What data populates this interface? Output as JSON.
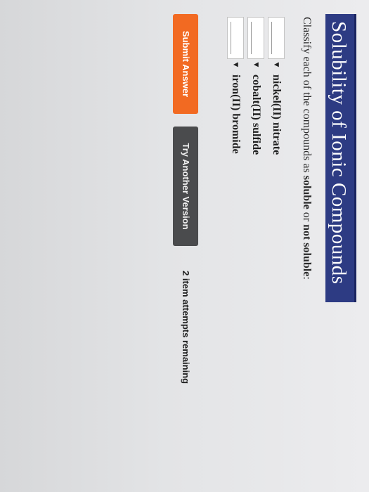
{
  "header": {
    "title": "Solubility of Ionic Compounds"
  },
  "instructions": {
    "prefix": "Classify each of the compounds as ",
    "soluble": "soluble",
    "middle": " or ",
    "not_soluble": "not soluble",
    "suffix": ":"
  },
  "compounds": [
    {
      "name": "nickel(II) nitrate",
      "selected": ""
    },
    {
      "name": "cobalt(II) sulfide",
      "selected": ""
    },
    {
      "name": "iron(II) bromide",
      "selected": ""
    }
  ],
  "icons": {
    "dropdown": "▼"
  },
  "actions": {
    "submit_label": "Submit Answer",
    "try_label": "Try Another Version",
    "attempts_text": "2 item attempts remaining"
  },
  "colors": {
    "title_bar": "#2d3b83",
    "submit_button": "#f26a22",
    "try_button": "#4a4b4d"
  }
}
